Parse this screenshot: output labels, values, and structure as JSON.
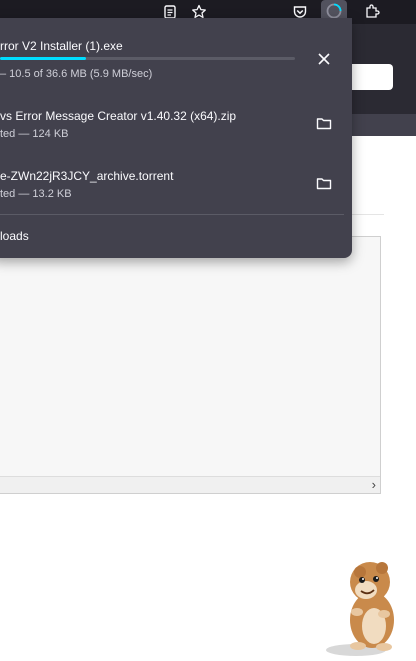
{
  "toolbar": {
    "icons": [
      "reader-view-icon",
      "bookmark-star-icon",
      "pocket-icon",
      "downloads-icon",
      "extensions-icon"
    ]
  },
  "downloads": {
    "items": [
      {
        "name": "rror V2 Installer (1).exe",
        "status": "– 10.5 of 36.6 MB (5.9 MB/sec)",
        "progress": 0.29,
        "action": "cancel"
      },
      {
        "name": "vs Error Message Creator v1.40.32 (x64).zip",
        "status": "ted — 124 KB",
        "action": "show-in-folder"
      },
      {
        "name": "e-ZWn22jR3JCY_archive.torrent",
        "status": "ted — 13.2 KB",
        "action": "show-in-folder"
      }
    ],
    "footer_label": "loads"
  },
  "page": {
    "scroll_arrow": "›"
  },
  "colors": {
    "accent": "#00ddff",
    "panel": "#42414d",
    "toolbar": "#1c1b22"
  }
}
